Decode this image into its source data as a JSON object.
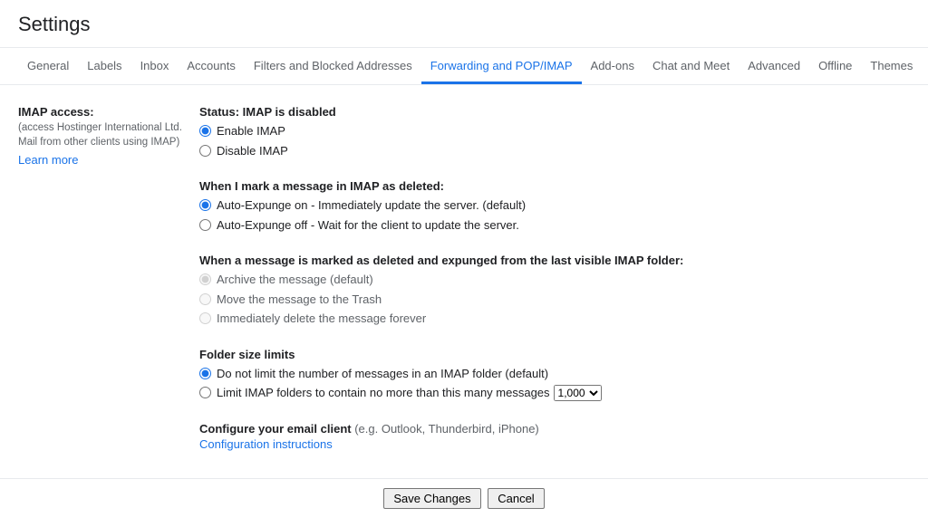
{
  "title": "Settings",
  "tabs": {
    "t0": "General",
    "t1": "Labels",
    "t2": "Inbox",
    "t3": "Accounts",
    "t4": "Filters and Blocked Addresses",
    "t5": "Forwarding and POP/IMAP",
    "t6": "Add-ons",
    "t7": "Chat and Meet",
    "t8": "Advanced",
    "t9": "Offline",
    "t10": "Themes"
  },
  "left": {
    "title": "IMAP access:",
    "sub": "(access Hostinger International Ltd. Mail from other clients using IMAP)",
    "learn_more": "Learn more"
  },
  "imap_status": {
    "heading": "Status: IMAP is disabled",
    "enable": "Enable IMAP",
    "disable": "Disable IMAP"
  },
  "deleted": {
    "heading": "When I mark a message in IMAP as deleted:",
    "opt_on": "Auto-Expunge on - Immediately update the server. (default)",
    "opt_off": "Auto-Expunge off - Wait for the client to update the server."
  },
  "expunged": {
    "heading": "When a message is marked as deleted and expunged from the last visible IMAP folder:",
    "opt_archive": "Archive the message (default)",
    "opt_trash": "Move the message to the Trash",
    "opt_delete": "Immediately delete the message forever"
  },
  "folder_limits": {
    "heading": "Folder size limits",
    "opt_unlimited": "Do not limit the number of messages in an IMAP folder (default)",
    "opt_limit": "Limit IMAP folders to contain no more than this many messages",
    "select_value": "1,000"
  },
  "configure": {
    "main": "Configure your email client",
    "supp": "(e.g. Outlook, Thunderbird, iPhone)",
    "link": "Configuration instructions"
  },
  "buttons": {
    "save": "Save Changes",
    "cancel": "Cancel"
  }
}
